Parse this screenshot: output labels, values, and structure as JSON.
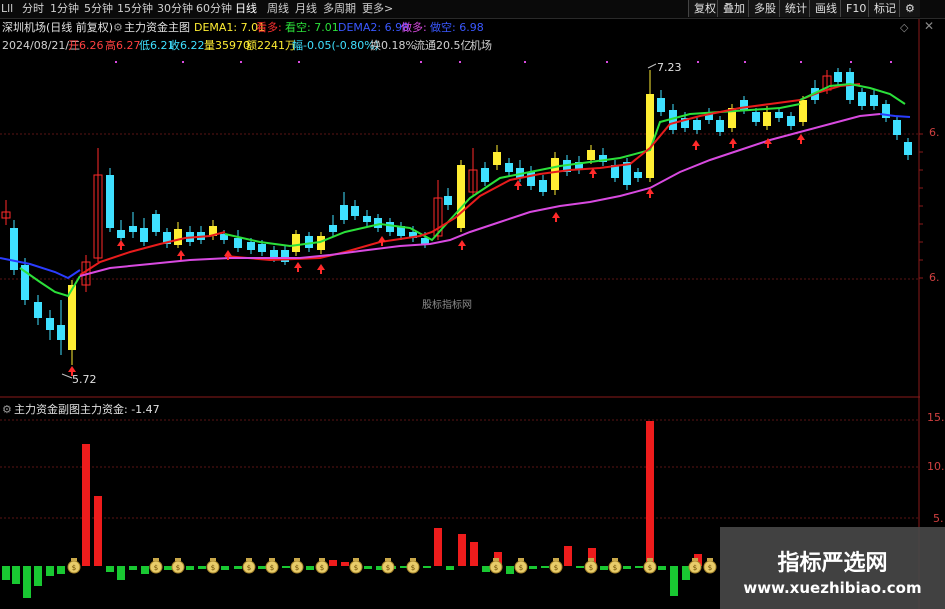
{
  "toolbar": {
    "left_items": [
      "Lll",
      "分时",
      "1分钟",
      "5分钟",
      "15分钟",
      "30分钟",
      "60分钟",
      "日线",
      "周线",
      "月线",
      "多周期",
      "更多>"
    ],
    "right_buttons": [
      "复权",
      "叠加",
      "多股",
      "统计",
      "画线",
      "F10",
      "标记",
      "⚙"
    ]
  },
  "header": {
    "line1_title": "深圳机场(日线 前复权)",
    "main_indicator": "主力资金主图",
    "dema1": "DEMA1: 7.01",
    "kanduo": "看多: ",
    "kankong": "看空: 7.01",
    "dema2": "DEMA2: 6.98",
    "zuoduo": "做多: ",
    "zuokong": "做空: 6.98",
    "date": "2024/08/21/三",
    "open": "开6.26",
    "high": "高6.27",
    "low": "低6.21",
    "close": "收6.22",
    "volume": "量35970",
    "amount": "额2241万",
    "change": "幅-0.05(-0.80%)",
    "turnover": "换0.18%",
    "float": "流通20.5亿",
    "sector": "机场"
  },
  "main_chart": {
    "high_label": "7.23",
    "low_label": "5.72",
    "watermark": "股标指标网",
    "price_axis_labels": [
      "6.",
      "6."
    ]
  },
  "sub_chart": {
    "title": "主力资金副图",
    "value_text": "主力资金: -1.47",
    "axis_labels": [
      "15.",
      "10.",
      "5."
    ]
  },
  "watermark_box": {
    "title": "指标严选网",
    "url": "www.xuezhibiao.com"
  },
  "colors": {
    "up": "#ff2a2a",
    "down": "#3fe0ff",
    "signal": "#ffee33",
    "fund_up": "#ee1c1c",
    "fund_down": "#19c832",
    "ma_red": "#e81c1c",
    "ma_green": "#2be03a",
    "ma_blue": "#2a3cff",
    "ma_magenta": "#d84ae0"
  }
}
